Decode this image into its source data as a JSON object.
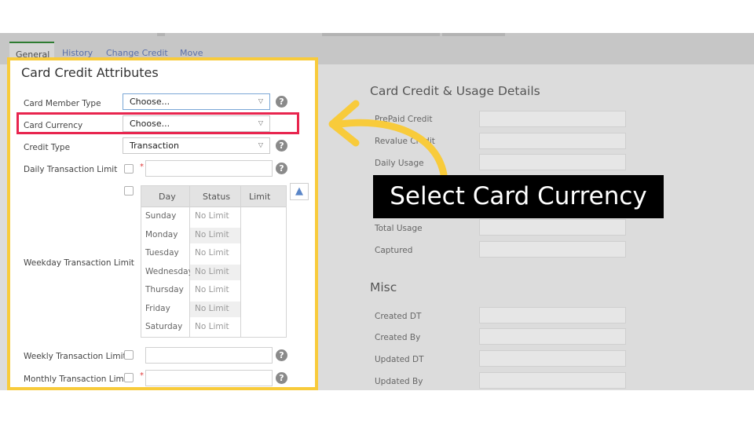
{
  "tabs": [
    "General",
    "History",
    "Change Credit",
    "Move"
  ],
  "panel": {
    "title": "Card Credit Attributes",
    "fields": {
      "member_type": {
        "label": "Card Member Type",
        "value": "Choose..."
      },
      "currency": {
        "label": "Card Currency",
        "value": "Choose..."
      },
      "credit_type": {
        "label": "Credit Type",
        "value": "Transaction"
      },
      "daily_limit": {
        "label": "Daily Transaction Limit"
      },
      "weekday_limit": {
        "label": "Weekday Transaction Limit"
      },
      "weekly_limit": {
        "label": "Weekly Transaction Limit"
      },
      "monthly_limit": {
        "label": "Monthly Transaction Limit"
      }
    },
    "required_mark": "*",
    "help_glyph": "?",
    "caret_glyph": "▽",
    "weekday_table": {
      "headers": [
        "Day",
        "Status",
        "Limit"
      ],
      "rows": [
        {
          "day": "Sunday",
          "status": "No Limit"
        },
        {
          "day": "Monday",
          "status": "No Limit"
        },
        {
          "day": "Tuesday",
          "status": "No Limit"
        },
        {
          "day": "Wednesday",
          "status": "No Limit"
        },
        {
          "day": "Thursday",
          "status": "No Limit"
        },
        {
          "day": "Friday",
          "status": "No Limit"
        },
        {
          "day": "Saturday",
          "status": "No Limit"
        }
      ]
    }
  },
  "details": {
    "title": "Card Credit & Usage Details",
    "fields": [
      "PrePaid Credit",
      "Revalue Credit",
      "Daily Usage",
      "",
      "",
      "Total Usage",
      "Captured"
    ]
  },
  "misc": {
    "title": "Misc",
    "fields": [
      "Created DT",
      "Created By",
      "Updated DT",
      "Updated By"
    ]
  },
  "callout": {
    "text": "Select Card Currency"
  },
  "icons": {
    "help": "help-icon",
    "upload": "upload-icon",
    "arrow": "curved-arrow-icon",
    "caret": "chevron-down-icon"
  },
  "colors": {
    "highlight_border": "#f8cb3b",
    "currency_highlight": "#e8254e",
    "callout_bg": "#000000",
    "active_tab_accent": "#2f7d32"
  }
}
